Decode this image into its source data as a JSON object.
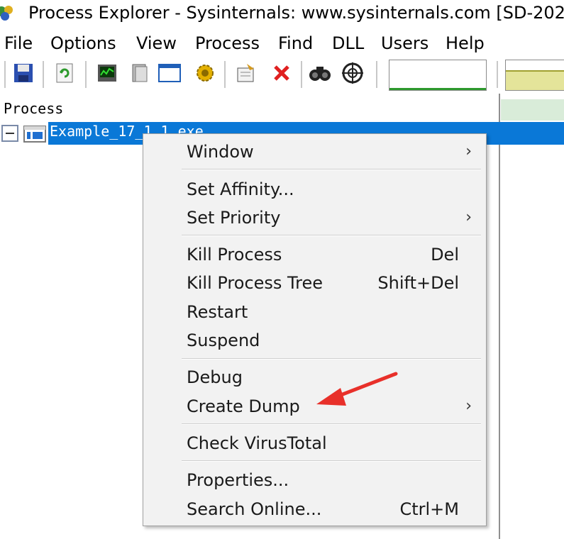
{
  "window": {
    "title": "Process Explorer - Sysinternals: www.sysinternals.com [SD-202"
  },
  "menubar": {
    "items": [
      "File",
      "Options",
      "View",
      "Process",
      "Find",
      "DLL",
      "Users",
      "Help"
    ]
  },
  "toolbar": {
    "buttons": [
      "save-icon",
      "refresh-icon",
      "system-information-icon",
      "properties-icon",
      "window-icon",
      "gear-icon",
      "process-properties-icon",
      "kill-process-icon",
      "find-icon",
      "target-icon"
    ]
  },
  "process_list": {
    "column_header": "Process",
    "rows": [
      {
        "name": "Example_17_1_1.exe",
        "selected": true
      }
    ]
  },
  "context_menu": {
    "items": [
      {
        "label": "Window",
        "shortcut": "",
        "submenu": true
      },
      {
        "label": "Set Affinity...",
        "shortcut": "",
        "submenu": false
      },
      {
        "label": "Set Priority",
        "shortcut": "",
        "submenu": true
      },
      {
        "label": "Kill Process",
        "shortcut": "Del",
        "submenu": false
      },
      {
        "label": "Kill Process Tree",
        "shortcut": "Shift+Del",
        "submenu": false
      },
      {
        "label": "Restart",
        "shortcut": "",
        "submenu": false
      },
      {
        "label": "Suspend",
        "shortcut": "",
        "submenu": false
      },
      {
        "label": "Debug",
        "shortcut": "",
        "submenu": false
      },
      {
        "label": "Create Dump",
        "shortcut": "",
        "submenu": true
      },
      {
        "label": "Check VirusTotal",
        "shortcut": "",
        "submenu": false
      },
      {
        "label": "Properties...",
        "shortcut": "",
        "submenu": false
      },
      {
        "label": "Search Online...",
        "shortcut": "Ctrl+M",
        "submenu": false
      }
    ],
    "submenu_glyph": "›"
  },
  "colors": {
    "selection": "#0a78d7",
    "annotation_arrow": "#e8302a",
    "menu_background": "#f2f2f2"
  }
}
